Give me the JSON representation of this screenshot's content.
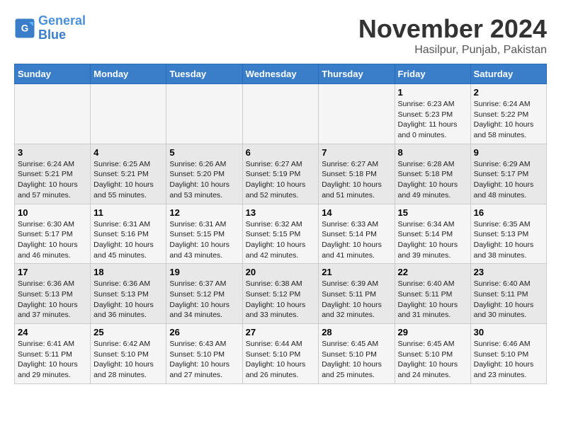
{
  "header": {
    "logo_line1": "General",
    "logo_line2": "Blue",
    "month_title": "November 2024",
    "location": "Hasilpur, Punjab, Pakistan"
  },
  "days_of_week": [
    "Sunday",
    "Monday",
    "Tuesday",
    "Wednesday",
    "Thursday",
    "Friday",
    "Saturday"
  ],
  "weeks": [
    [
      {
        "day": "",
        "info": ""
      },
      {
        "day": "",
        "info": ""
      },
      {
        "day": "",
        "info": ""
      },
      {
        "day": "",
        "info": ""
      },
      {
        "day": "",
        "info": ""
      },
      {
        "day": "1",
        "info": "Sunrise: 6:23 AM\nSunset: 5:23 PM\nDaylight: 11 hours and 0 minutes."
      },
      {
        "day": "2",
        "info": "Sunrise: 6:24 AM\nSunset: 5:22 PM\nDaylight: 10 hours and 58 minutes."
      }
    ],
    [
      {
        "day": "3",
        "info": "Sunrise: 6:24 AM\nSunset: 5:21 PM\nDaylight: 10 hours and 57 minutes."
      },
      {
        "day": "4",
        "info": "Sunrise: 6:25 AM\nSunset: 5:21 PM\nDaylight: 10 hours and 55 minutes."
      },
      {
        "day": "5",
        "info": "Sunrise: 6:26 AM\nSunset: 5:20 PM\nDaylight: 10 hours and 53 minutes."
      },
      {
        "day": "6",
        "info": "Sunrise: 6:27 AM\nSunset: 5:19 PM\nDaylight: 10 hours and 52 minutes."
      },
      {
        "day": "7",
        "info": "Sunrise: 6:27 AM\nSunset: 5:18 PM\nDaylight: 10 hours and 51 minutes."
      },
      {
        "day": "8",
        "info": "Sunrise: 6:28 AM\nSunset: 5:18 PM\nDaylight: 10 hours and 49 minutes."
      },
      {
        "day": "9",
        "info": "Sunrise: 6:29 AM\nSunset: 5:17 PM\nDaylight: 10 hours and 48 minutes."
      }
    ],
    [
      {
        "day": "10",
        "info": "Sunrise: 6:30 AM\nSunset: 5:17 PM\nDaylight: 10 hours and 46 minutes."
      },
      {
        "day": "11",
        "info": "Sunrise: 6:31 AM\nSunset: 5:16 PM\nDaylight: 10 hours and 45 minutes."
      },
      {
        "day": "12",
        "info": "Sunrise: 6:31 AM\nSunset: 5:15 PM\nDaylight: 10 hours and 43 minutes."
      },
      {
        "day": "13",
        "info": "Sunrise: 6:32 AM\nSunset: 5:15 PM\nDaylight: 10 hours and 42 minutes."
      },
      {
        "day": "14",
        "info": "Sunrise: 6:33 AM\nSunset: 5:14 PM\nDaylight: 10 hours and 41 minutes."
      },
      {
        "day": "15",
        "info": "Sunrise: 6:34 AM\nSunset: 5:14 PM\nDaylight: 10 hours and 39 minutes."
      },
      {
        "day": "16",
        "info": "Sunrise: 6:35 AM\nSunset: 5:13 PM\nDaylight: 10 hours and 38 minutes."
      }
    ],
    [
      {
        "day": "17",
        "info": "Sunrise: 6:36 AM\nSunset: 5:13 PM\nDaylight: 10 hours and 37 minutes."
      },
      {
        "day": "18",
        "info": "Sunrise: 6:36 AM\nSunset: 5:13 PM\nDaylight: 10 hours and 36 minutes."
      },
      {
        "day": "19",
        "info": "Sunrise: 6:37 AM\nSunset: 5:12 PM\nDaylight: 10 hours and 34 minutes."
      },
      {
        "day": "20",
        "info": "Sunrise: 6:38 AM\nSunset: 5:12 PM\nDaylight: 10 hours and 33 minutes."
      },
      {
        "day": "21",
        "info": "Sunrise: 6:39 AM\nSunset: 5:11 PM\nDaylight: 10 hours and 32 minutes."
      },
      {
        "day": "22",
        "info": "Sunrise: 6:40 AM\nSunset: 5:11 PM\nDaylight: 10 hours and 31 minutes."
      },
      {
        "day": "23",
        "info": "Sunrise: 6:40 AM\nSunset: 5:11 PM\nDaylight: 10 hours and 30 minutes."
      }
    ],
    [
      {
        "day": "24",
        "info": "Sunrise: 6:41 AM\nSunset: 5:11 PM\nDaylight: 10 hours and 29 minutes."
      },
      {
        "day": "25",
        "info": "Sunrise: 6:42 AM\nSunset: 5:10 PM\nDaylight: 10 hours and 28 minutes."
      },
      {
        "day": "26",
        "info": "Sunrise: 6:43 AM\nSunset: 5:10 PM\nDaylight: 10 hours and 27 minutes."
      },
      {
        "day": "27",
        "info": "Sunrise: 6:44 AM\nSunset: 5:10 PM\nDaylight: 10 hours and 26 minutes."
      },
      {
        "day": "28",
        "info": "Sunrise: 6:45 AM\nSunset: 5:10 PM\nDaylight: 10 hours and 25 minutes."
      },
      {
        "day": "29",
        "info": "Sunrise: 6:45 AM\nSunset: 5:10 PM\nDaylight: 10 hours and 24 minutes."
      },
      {
        "day": "30",
        "info": "Sunrise: 6:46 AM\nSunset: 5:10 PM\nDaylight: 10 hours and 23 minutes."
      }
    ]
  ]
}
